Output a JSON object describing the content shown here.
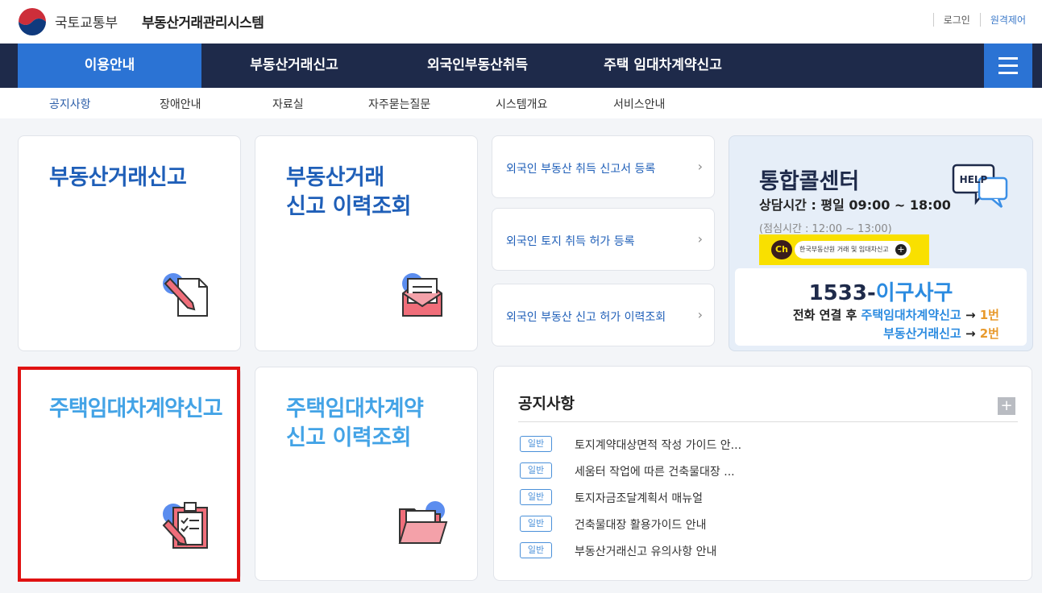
{
  "header": {
    "ministry": "국토교통부",
    "system_name": "부동산거래관리시스템",
    "login": "로그인",
    "remote": "원격제어"
  },
  "gnb": [
    {
      "label": "이용안내",
      "active": true
    },
    {
      "label": "부동산거래신고",
      "active": false
    },
    {
      "label": "외국인부동산취득",
      "active": false
    },
    {
      "label": "주택 임대차계약신고",
      "active": false
    }
  ],
  "lnb": [
    {
      "label": "공지사항",
      "active": true
    },
    {
      "label": "장애안내"
    },
    {
      "label": "자료실"
    },
    {
      "label": "자주묻는질문"
    },
    {
      "label": "시스템개요"
    },
    {
      "label": "서비스안내"
    }
  ],
  "cards": {
    "realestate": {
      "title": "부동산거래신고"
    },
    "realestate_history": {
      "line1": "부동산거래",
      "line2": "신고 이력조회"
    },
    "rental": {
      "title": "주택임대차계약신고"
    },
    "rental_history": {
      "line1": "주택임대차계약",
      "line2": "신고 이력조회"
    }
  },
  "links": [
    "외국인 부동산 취득 신고서 등록",
    "외국인 토지 취득 허가 등록",
    "외국인 부동산 신고 허가 이력조회"
  ],
  "call_center": {
    "title": "통합콜센터",
    "hours": "상담시간 : 평일 09:00 ~ 18:00",
    "break": "(점심시간 : 12:00 ~ 13:00)",
    "help_badge": "HELP",
    "kakao_ch": "Ch",
    "kakao_label": "한국부동산원 거래 및 임대차신고",
    "number_prefix": "1533-",
    "number_word": "이구사구",
    "line1_prefix": "전화 연결 후 ",
    "line1_target": "주택임대차계약신고",
    "line1_arrow": " → ",
    "line1_num": "1번",
    "line2_target": "부동산거래신고",
    "line2_arrow": " → ",
    "line2_num": "2번"
  },
  "notice": {
    "title": "공지사항",
    "items": [
      {
        "badge": "일반",
        "text": "토지계약대상면적 작성 가이드 안..."
      },
      {
        "badge": "일반",
        "text": "세움터 작업에 따른 건축물대장 ..."
      },
      {
        "badge": "일반",
        "text": "토지자금조달계획서 매뉴얼"
      },
      {
        "badge": "일반",
        "text": "건축물대장 활용가이드 안내"
      },
      {
        "badge": "일반",
        "text": "부동산거래신고 유의사항 안내"
      }
    ]
  }
}
